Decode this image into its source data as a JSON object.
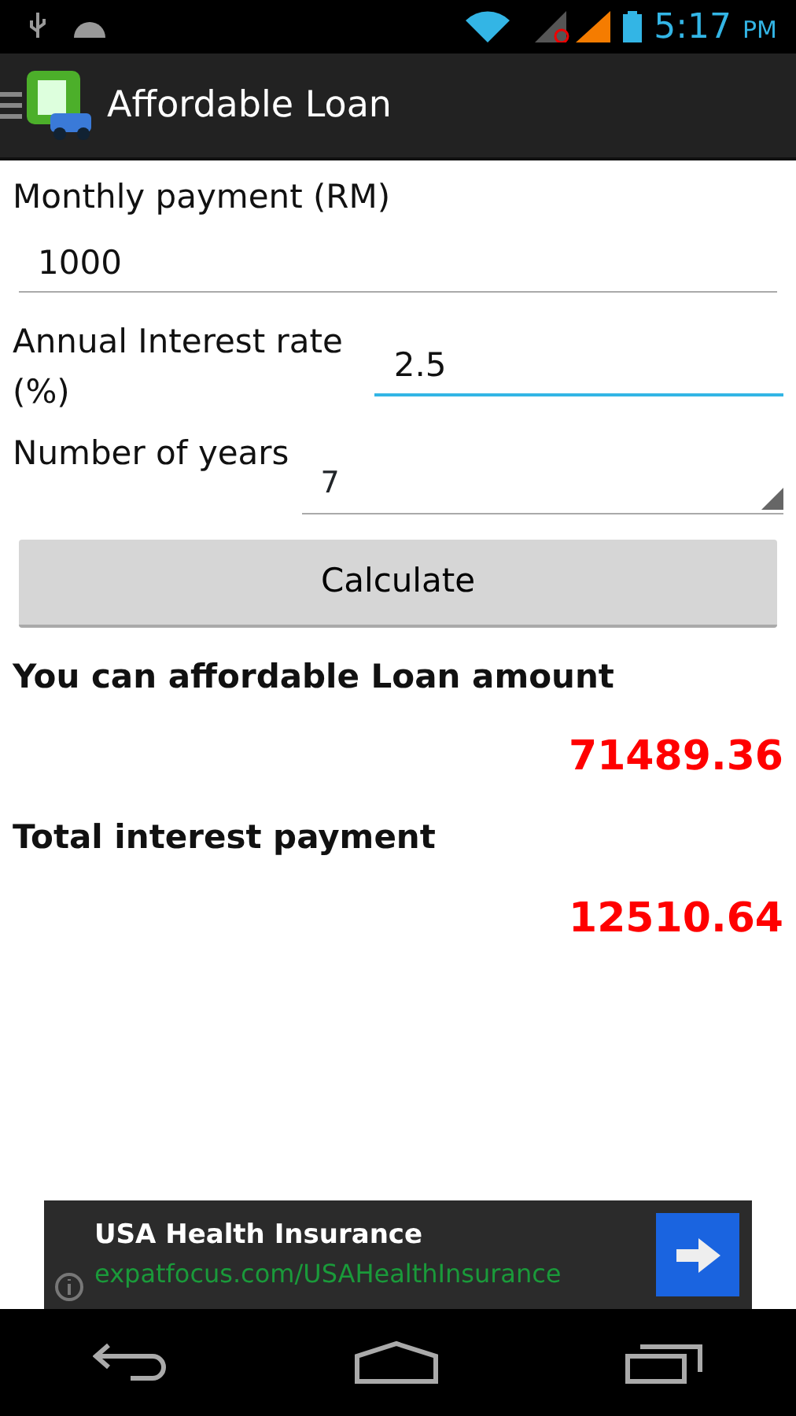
{
  "status_bar": {
    "time": "5:17",
    "ampm": "PM"
  },
  "action_bar": {
    "title": "Affordable Loan"
  },
  "form": {
    "monthly_label": "Monthly payment (RM)",
    "monthly_value": "1000",
    "monthly_focused": false,
    "rate_label": "Annual Interest rate (%)",
    "rate_value": "2.5",
    "rate_focused": true,
    "years_label": "Number of years",
    "years_value": "7"
  },
  "calculate_button": "Calculate",
  "results": [
    {
      "label": "You can affordable Loan amount",
      "value": "71489.36"
    },
    {
      "label": "Total interest payment",
      "value": "12510.64"
    }
  ],
  "ad": {
    "title": "USA Health Insurance",
    "url": "expatfocus.com/USAHealthInsurance"
  }
}
